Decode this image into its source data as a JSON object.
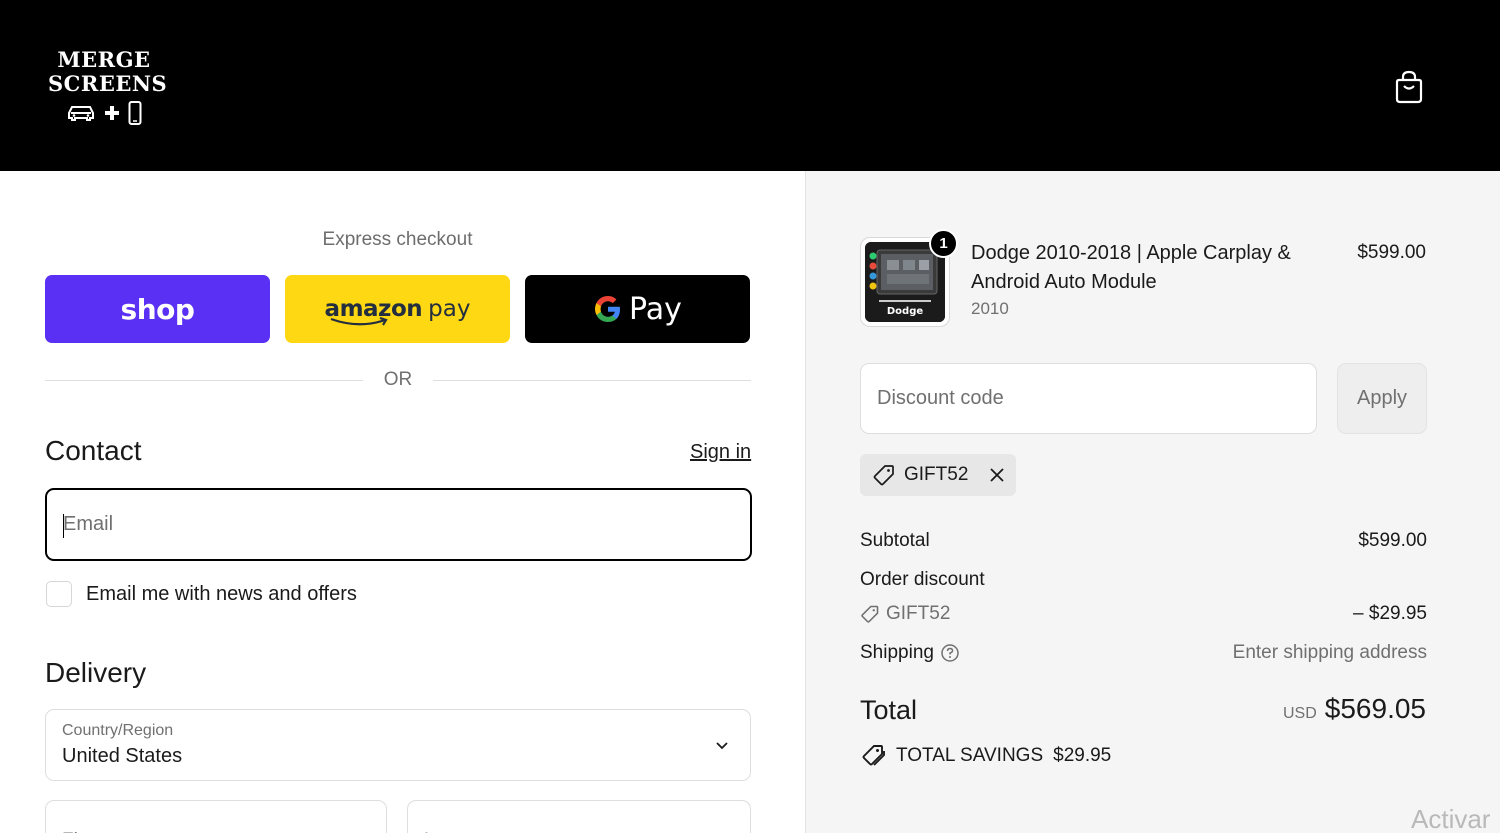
{
  "header": {
    "logo_line1": "MERGE",
    "logo_line2": "SCREENS",
    "cart_icon": "shopping-bag-icon"
  },
  "express": {
    "title": "Express checkout",
    "shop_pay_label": "shop",
    "amazon_word": "amazon",
    "amazon_pay_word": "pay",
    "google_pay_label": "Pay",
    "or_text": "OR"
  },
  "contact": {
    "heading": "Contact",
    "sign_in": "Sign in",
    "email_placeholder": "Email",
    "news_offers_label": "Email me with news and offers"
  },
  "delivery": {
    "heading": "Delivery",
    "country_label": "Country/Region",
    "country_value": "United States",
    "first_name_placeholder": "First name",
    "last_name_placeholder": "Last name"
  },
  "summary": {
    "product": {
      "quantity": "1",
      "title": "Dodge 2010-2018 | Apple Carplay & Android Auto Module",
      "variant": "2010",
      "price": "$599.00",
      "thumb_label": "Dodge"
    },
    "discount_placeholder": "Discount code",
    "apply_label": "Apply",
    "applied_code": "GIFT52",
    "subtotal_label": "Subtotal",
    "subtotal_value": "$599.00",
    "order_discount_label": "Order discount",
    "order_discount_code": "GIFT52",
    "order_discount_value": "– $29.95",
    "shipping_label": "Shipping",
    "shipping_value": "Enter shipping address",
    "total_label": "Total",
    "total_currency": "USD",
    "total_value": "$569.05",
    "savings_label": "TOTAL SAVINGS",
    "savings_value": "$29.95"
  },
  "watermark": "Activar",
  "colors": {
    "shop_pay": "#5a31f4",
    "amazon_pay": "#ffd814",
    "google_pay": "#000000",
    "header_bg": "#000000",
    "summary_bg": "#f5f5f5"
  }
}
